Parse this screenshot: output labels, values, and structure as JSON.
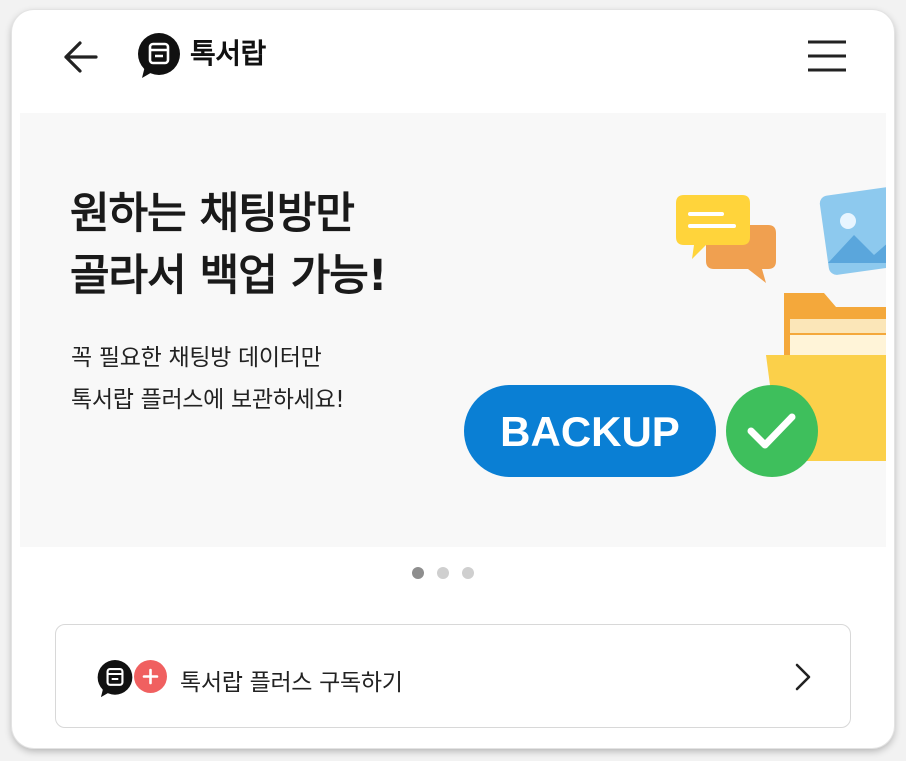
{
  "header": {
    "app_name": "톡서랍"
  },
  "banner": {
    "headline_line1": "원하는 채팅방만",
    "headline_line2": "골라서 백업 가능!",
    "sub_line1": "꼭 필요한 채팅방 데이터만",
    "sub_line2": "톡서랍 플러스에 보관하세요!",
    "badge_text": "BACKUP"
  },
  "carousel": {
    "slide_count": 3,
    "active_index": 0
  },
  "subscribe": {
    "label": "톡서랍 플러스 구독하기"
  },
  "colors": {
    "backup_blue": "#0a7fd4",
    "check_green": "#3ebf5c",
    "plus_red": "#f06060",
    "folder_yellow": "#fbd04a"
  },
  "icons": [
    "back-arrow-icon",
    "chat-drawer-logo-icon",
    "menu-icon",
    "plus-icon",
    "chevron-right-icon"
  ]
}
